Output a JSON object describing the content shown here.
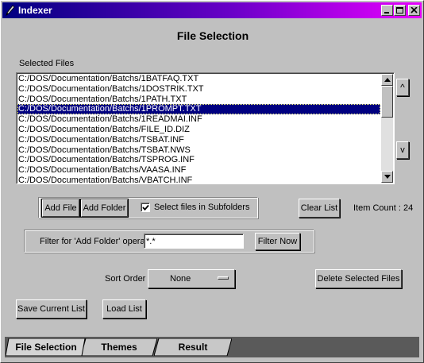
{
  "window": {
    "title": "Indexer"
  },
  "page_title": "File Selection",
  "selected_files_label": "Selected Files",
  "files": [
    "C:/DOS/Documentation/Batchs/1BATFAQ.TXT",
    "C:/DOS/Documentation/Batchs/1DOSTRIK.TXT",
    "C:/DOS/Documentation/Batchs/1PATH.TXT",
    "C:/DOS/Documentation/Batchs/1PROMPT.TXT",
    "C:/DOS/Documentation/Batchs/1READMAI.INF",
    "C:/DOS/Documentation/Batchs/FILE_ID.DIZ",
    "C:/DOS/Documentation/Batchs/TSBAT.INF",
    "C:/DOS/Documentation/Batchs/TSBAT.NWS",
    "C:/DOS/Documentation/Batchs/TSPROG.INF",
    "C:/DOS/Documentation/Batchs/VAASA.INF",
    "C:/DOS/Documentation/Batchs/VBATCH.INF"
  ],
  "selected_index": 3,
  "move_up_label": "^",
  "move_down_label": "v",
  "buttons": {
    "add_file": "Add File",
    "add_folder": "Add Folder",
    "clear_list": "Clear List",
    "filter_now": "Filter Now",
    "delete_selected": "Delete Selected Files",
    "save_list": "Save Current List",
    "load_list": "Load List"
  },
  "subfolders": {
    "label": "Select files in Subfolders",
    "checked": true
  },
  "item_count": "Item Count : 24",
  "filter": {
    "label": "Filter for 'Add Folder' operation",
    "value": "*.*"
  },
  "sort": {
    "label": "Sort Order",
    "value": "None"
  },
  "tabs": [
    {
      "label": "File Selection",
      "active": true
    },
    {
      "label": "Themes",
      "active": false
    },
    {
      "label": "Result",
      "active": false
    }
  ],
  "icons": {
    "app": "pen-icon",
    "minimize": "minimize-icon",
    "maximize": "maximize-icon",
    "close": "close-icon"
  },
  "colors": {
    "selection": "#000080",
    "face": "#c0c0c0",
    "title_start": "#000080",
    "title_end": "#e800ff",
    "tab_strip": "#5a5a5a"
  }
}
